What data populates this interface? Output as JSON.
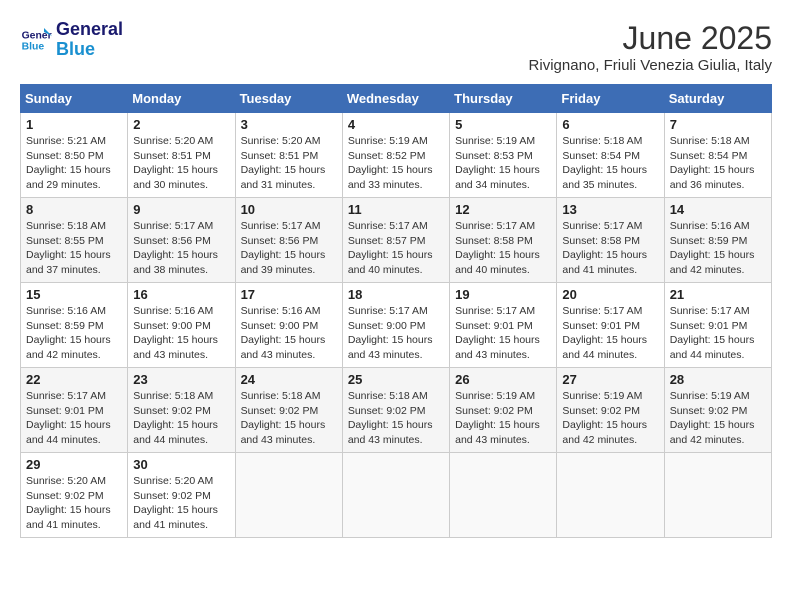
{
  "header": {
    "logo_line1": "General",
    "logo_line2": "Blue",
    "month_year": "June 2025",
    "location": "Rivignano, Friuli Venezia Giulia, Italy"
  },
  "weekdays": [
    "Sunday",
    "Monday",
    "Tuesday",
    "Wednesday",
    "Thursday",
    "Friday",
    "Saturday"
  ],
  "weeks": [
    [
      {
        "day": "1",
        "sunrise": "5:21 AM",
        "sunset": "8:50 PM",
        "daylight": "15 hours and 29 minutes."
      },
      {
        "day": "2",
        "sunrise": "5:20 AM",
        "sunset": "8:51 PM",
        "daylight": "15 hours and 30 minutes."
      },
      {
        "day": "3",
        "sunrise": "5:20 AM",
        "sunset": "8:51 PM",
        "daylight": "15 hours and 31 minutes."
      },
      {
        "day": "4",
        "sunrise": "5:19 AM",
        "sunset": "8:52 PM",
        "daylight": "15 hours and 33 minutes."
      },
      {
        "day": "5",
        "sunrise": "5:19 AM",
        "sunset": "8:53 PM",
        "daylight": "15 hours and 34 minutes."
      },
      {
        "day": "6",
        "sunrise": "5:18 AM",
        "sunset": "8:54 PM",
        "daylight": "15 hours and 35 minutes."
      },
      {
        "day": "7",
        "sunrise": "5:18 AM",
        "sunset": "8:54 PM",
        "daylight": "15 hours and 36 minutes."
      }
    ],
    [
      {
        "day": "8",
        "sunrise": "5:18 AM",
        "sunset": "8:55 PM",
        "daylight": "15 hours and 37 minutes."
      },
      {
        "day": "9",
        "sunrise": "5:17 AM",
        "sunset": "8:56 PM",
        "daylight": "15 hours and 38 minutes."
      },
      {
        "day": "10",
        "sunrise": "5:17 AM",
        "sunset": "8:56 PM",
        "daylight": "15 hours and 39 minutes."
      },
      {
        "day": "11",
        "sunrise": "5:17 AM",
        "sunset": "8:57 PM",
        "daylight": "15 hours and 40 minutes."
      },
      {
        "day": "12",
        "sunrise": "5:17 AM",
        "sunset": "8:58 PM",
        "daylight": "15 hours and 40 minutes."
      },
      {
        "day": "13",
        "sunrise": "5:17 AM",
        "sunset": "8:58 PM",
        "daylight": "15 hours and 41 minutes."
      },
      {
        "day": "14",
        "sunrise": "5:16 AM",
        "sunset": "8:59 PM",
        "daylight": "15 hours and 42 minutes."
      }
    ],
    [
      {
        "day": "15",
        "sunrise": "5:16 AM",
        "sunset": "8:59 PM",
        "daylight": "15 hours and 42 minutes."
      },
      {
        "day": "16",
        "sunrise": "5:16 AM",
        "sunset": "9:00 PM",
        "daylight": "15 hours and 43 minutes."
      },
      {
        "day": "17",
        "sunrise": "5:16 AM",
        "sunset": "9:00 PM",
        "daylight": "15 hours and 43 minutes."
      },
      {
        "day": "18",
        "sunrise": "5:17 AM",
        "sunset": "9:00 PM",
        "daylight": "15 hours and 43 minutes."
      },
      {
        "day": "19",
        "sunrise": "5:17 AM",
        "sunset": "9:01 PM",
        "daylight": "15 hours and 43 minutes."
      },
      {
        "day": "20",
        "sunrise": "5:17 AM",
        "sunset": "9:01 PM",
        "daylight": "15 hours and 44 minutes."
      },
      {
        "day": "21",
        "sunrise": "5:17 AM",
        "sunset": "9:01 PM",
        "daylight": "15 hours and 44 minutes."
      }
    ],
    [
      {
        "day": "22",
        "sunrise": "5:17 AM",
        "sunset": "9:01 PM",
        "daylight": "15 hours and 44 minutes."
      },
      {
        "day": "23",
        "sunrise": "5:18 AM",
        "sunset": "9:02 PM",
        "daylight": "15 hours and 44 minutes."
      },
      {
        "day": "24",
        "sunrise": "5:18 AM",
        "sunset": "9:02 PM",
        "daylight": "15 hours and 43 minutes."
      },
      {
        "day": "25",
        "sunrise": "5:18 AM",
        "sunset": "9:02 PM",
        "daylight": "15 hours and 43 minutes."
      },
      {
        "day": "26",
        "sunrise": "5:19 AM",
        "sunset": "9:02 PM",
        "daylight": "15 hours and 43 minutes."
      },
      {
        "day": "27",
        "sunrise": "5:19 AM",
        "sunset": "9:02 PM",
        "daylight": "15 hours and 42 minutes."
      },
      {
        "day": "28",
        "sunrise": "5:19 AM",
        "sunset": "9:02 PM",
        "daylight": "15 hours and 42 minutes."
      }
    ],
    [
      {
        "day": "29",
        "sunrise": "5:20 AM",
        "sunset": "9:02 PM",
        "daylight": "15 hours and 41 minutes."
      },
      {
        "day": "30",
        "sunrise": "5:20 AM",
        "sunset": "9:02 PM",
        "daylight": "15 hours and 41 minutes."
      },
      null,
      null,
      null,
      null,
      null
    ]
  ],
  "labels": {
    "sunrise": "Sunrise:",
    "sunset": "Sunset:",
    "daylight": "Daylight:"
  }
}
